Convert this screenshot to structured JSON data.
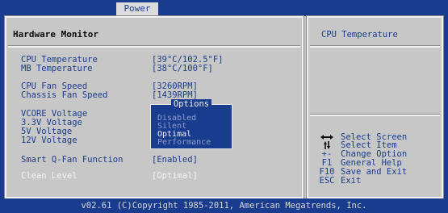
{
  "tabs": {
    "power": "Power"
  },
  "left": {
    "title": "Hardware Monitor",
    "rows": [
      {
        "label": "CPU Temperature",
        "value": "[39°C/102.5°F]"
      },
      {
        "label": "MB Temperature",
        "value": "[38°C/100°F]"
      },
      {
        "label": "CPU Fan Speed",
        "value": "[3260RPM]"
      },
      {
        "label": "Chassis Fan Speed",
        "value": "[1439RPM]"
      },
      {
        "label": "VCORE Voltage",
        "value": ""
      },
      {
        "label": "3.3V Voltage",
        "value": ""
      },
      {
        "label": "5V Voltage",
        "value": ""
      },
      {
        "label": "12V Voltage",
        "value": ""
      },
      {
        "label": "Smart Q-Fan Function",
        "value": "[Enabled]"
      },
      {
        "label": "Clean Level",
        "value": "[Optimal]"
      }
    ]
  },
  "popup": {
    "title": "Options",
    "options": [
      "Disabled",
      "Silent",
      "Optimal",
      "Performance"
    ],
    "selected": "Optimal"
  },
  "right": {
    "help_title": "CPU Temperature",
    "keys": [
      {
        "key_icon": "left-right-arrows-icon",
        "desc": "Select Screen"
      },
      {
        "key_icon": "up-down-arrows-icon",
        "desc": "Select Item"
      },
      {
        "key": "+-",
        "desc": "Change Option"
      },
      {
        "key": "F1",
        "desc": "General Help"
      },
      {
        "key": "F10",
        "desc": "Save and Exit"
      },
      {
        "key": "ESC",
        "desc": "Exit"
      }
    ]
  },
  "footer": "v02.61 (C)Copyright 1985-2011, American Megatrends, Inc.",
  "colors": {
    "bios_blue": "#1a3c8e",
    "panel_gray": "#c7c7c7",
    "highlight": "#f4f4f4"
  }
}
